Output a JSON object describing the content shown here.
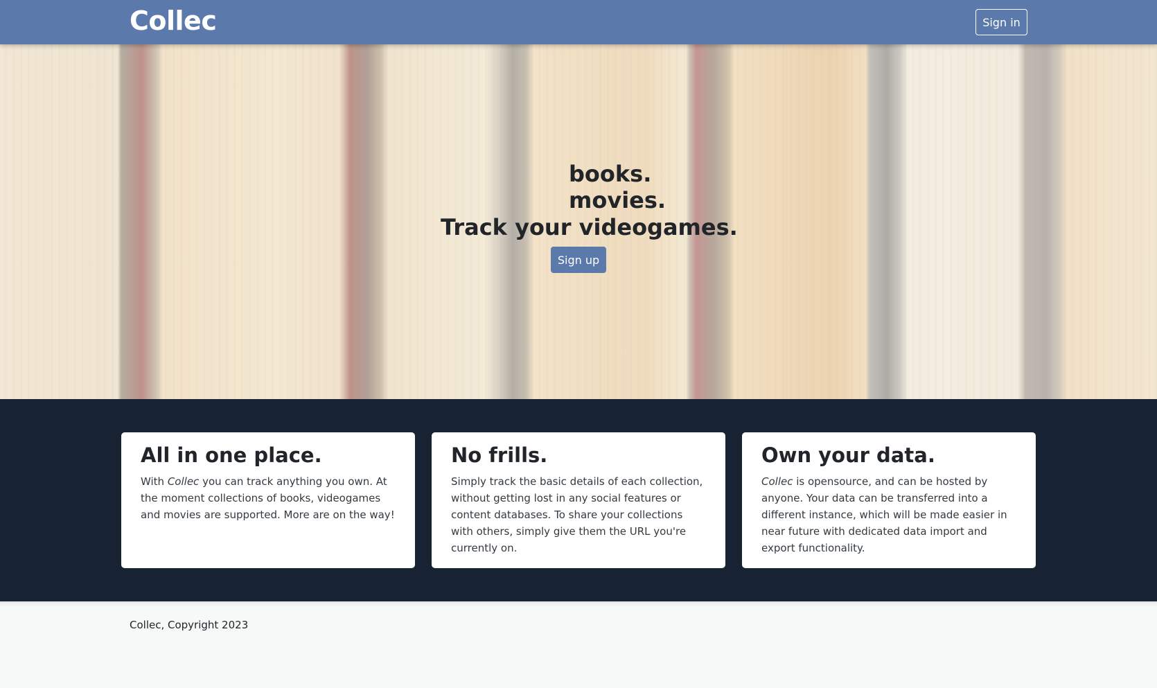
{
  "navbar": {
    "brand": "Collec",
    "signin_label": "Sign in",
    "background_color": "#5b79ab"
  },
  "hero": {
    "rotating_words": [
      "books.",
      "movies."
    ],
    "headline": "Track your videogames.",
    "signup_label": "Sign up"
  },
  "features": {
    "background_color": "#172333",
    "cards": [
      {
        "title": "All in one place.",
        "text_before": "With ",
        "emphasis": "Collec",
        "text_after": " you can track anything you own. At the moment collections of books, videogames and movies are supported. More are on the way!"
      },
      {
        "title": "No frills.",
        "text": "Simply track the basic details of each collection, without getting lost in any social features or content databases. To share your collections with others, simply give them the URL you're currently on."
      },
      {
        "title": "Own your data.",
        "emphasis": "Collec",
        "text_after": " is opensource, and can be hosted by anyone. Your data can be transferred into a different instance, which will be made easier in near future with dedicated data import and export functionality."
      }
    ]
  },
  "footer": {
    "copyright": "Collec, Copyright 2023"
  }
}
